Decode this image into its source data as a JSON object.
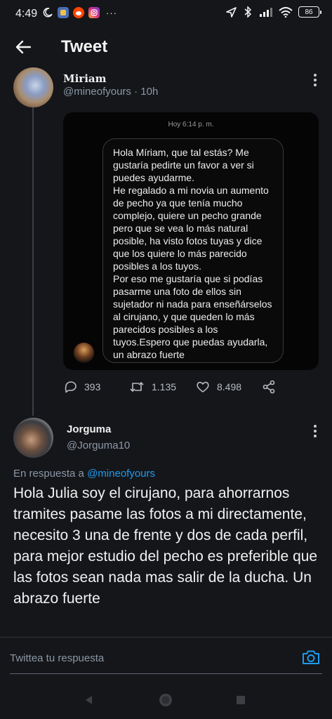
{
  "status_bar": {
    "time": "4:49",
    "battery": "86",
    "left_icons": [
      "moon-icon",
      "app-icon",
      "reddit-icon",
      "instagram-icon",
      "more-icon"
    ],
    "right_icons": [
      "location-icon",
      "bluetooth-icon",
      "signal-icon",
      "wifi-icon",
      "battery-icon"
    ]
  },
  "header": {
    "title": "Tweet"
  },
  "original_tweet": {
    "name": "Miriam",
    "handle": "@mineofyours",
    "time": "· 10h",
    "media": {
      "timestamp": "Hoy 6:14 p. m.",
      "message": "Hola Míriam, que tal estás? Me gustaría pedirte un favor a ver si puedes ayudarme.\nHe regalado a mi novia un aumento de pecho ya que tenía mucho complejo, quiere un pecho grande pero que se vea lo más natural posible, ha visto fotos tuyas y dice que los quiere lo más parecido posibles a los tuyos.\nPor eso me gustaría que si podías pasarme una foto de ellos sin sujetador ni nada para enseñárselos al cirujano, y que queden lo más parecidos posibles a los tuyos.Espero que puedas ayudarla, un abrazo fuerte"
    },
    "actions": {
      "replies": "393",
      "retweets": "1.135",
      "likes": "8.498"
    }
  },
  "reply_tweet": {
    "name": "Jorguma",
    "handle": "@Jorguma10",
    "reply_prefix": "En respuesta a",
    "reply_mention": "@mineofyours",
    "text": "Hola Julia soy el cirujano, para ahorrarnos tramites pasame las fotos a mi directamente, necesito 3 una de frente y dos de cada perfil, para mejor estudio del pecho es preferible que las fotos sean nada mas salir de la ducha. Un abrazo fuerte"
  },
  "reply_box": {
    "placeholder": "Twittea tu respuesta"
  },
  "colors": {
    "background": "#15161a",
    "accent": "#1d9bf0",
    "muted": "#8b98a5"
  }
}
